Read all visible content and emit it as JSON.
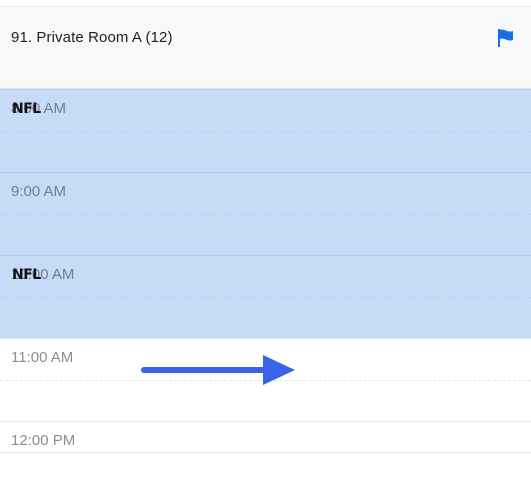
{
  "room": {
    "title": "91. Private Room A (12)",
    "flag_icon": "flag-icon",
    "accent": "#1a6fe0"
  },
  "slots": [
    {
      "time": "8:00 AM",
      "booked": true
    },
    {
      "time": "9:00 AM",
      "booked": true
    },
    {
      "time": "10:00 AM",
      "booked": true
    },
    {
      "time": "11:00 AM",
      "booked": false
    },
    {
      "time": "12:00 PM",
      "booked": false
    }
  ],
  "events": [
    {
      "label": "NFL"
    },
    {
      "label": "NFL"
    }
  ],
  "colors": {
    "booked_bg": "#c6dbf5",
    "arrow": "#3a63e8"
  },
  "annotation": {
    "icon": "arrow-right-icon"
  }
}
